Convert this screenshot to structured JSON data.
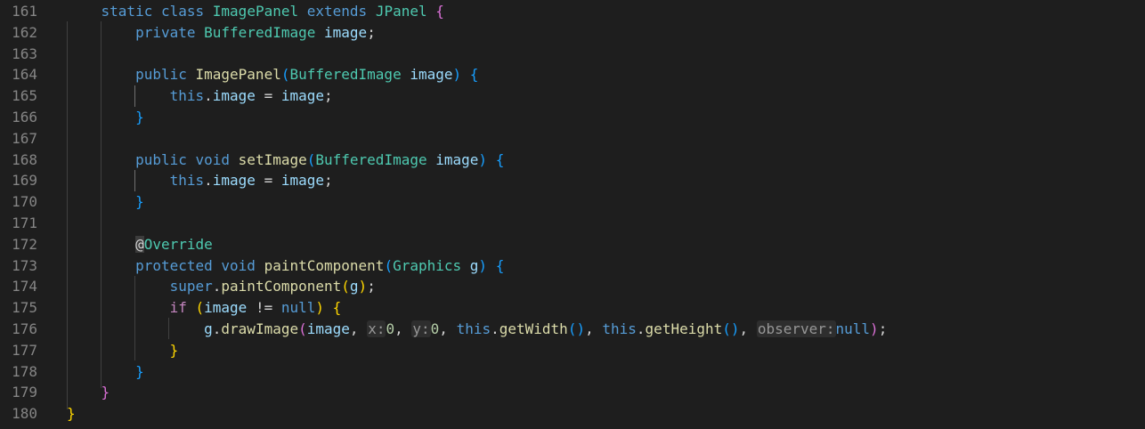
{
  "editor": {
    "lines": [
      {
        "n": "161"
      },
      {
        "n": "162"
      },
      {
        "n": "163"
      },
      {
        "n": "164"
      },
      {
        "n": "165"
      },
      {
        "n": "166"
      },
      {
        "n": "167"
      },
      {
        "n": "168"
      },
      {
        "n": "169"
      },
      {
        "n": "170"
      },
      {
        "n": "171"
      },
      {
        "n": "172"
      },
      {
        "n": "173"
      },
      {
        "n": "174"
      },
      {
        "n": "175"
      },
      {
        "n": "176"
      },
      {
        "n": "177"
      },
      {
        "n": "178"
      },
      {
        "n": "179"
      },
      {
        "n": "180"
      }
    ],
    "tokens": {
      "static": "static",
      "class": "class",
      "ImagePanel": "ImagePanel",
      "extends": "extends",
      "JPanel": "JPanel",
      "private": "private",
      "public": "public",
      "protected": "protected",
      "void": "void",
      "BufferedImage": "BufferedImage",
      "image": "image",
      "this": "this",
      "setImage": "setImage",
      "at": "@",
      "Override": "Override",
      "paintComponent": "paintComponent",
      "Graphics": "Graphics",
      "g": "g",
      "super": "super",
      "if": "if",
      "neq": "!=",
      "null": "null",
      "drawImage": "drawImage",
      "hint_x": "x:",
      "hint_y": "y:",
      "zero": "0",
      "getWidth": "getWidth",
      "getHeight": "getHeight",
      "hint_observer": "observer:",
      "eq": "=",
      "semi": ";",
      "dot": ".",
      "comma": ",",
      "lparen": "(",
      "rparen": ")",
      "lbrace": "{",
      "rbrace": "}"
    }
  }
}
